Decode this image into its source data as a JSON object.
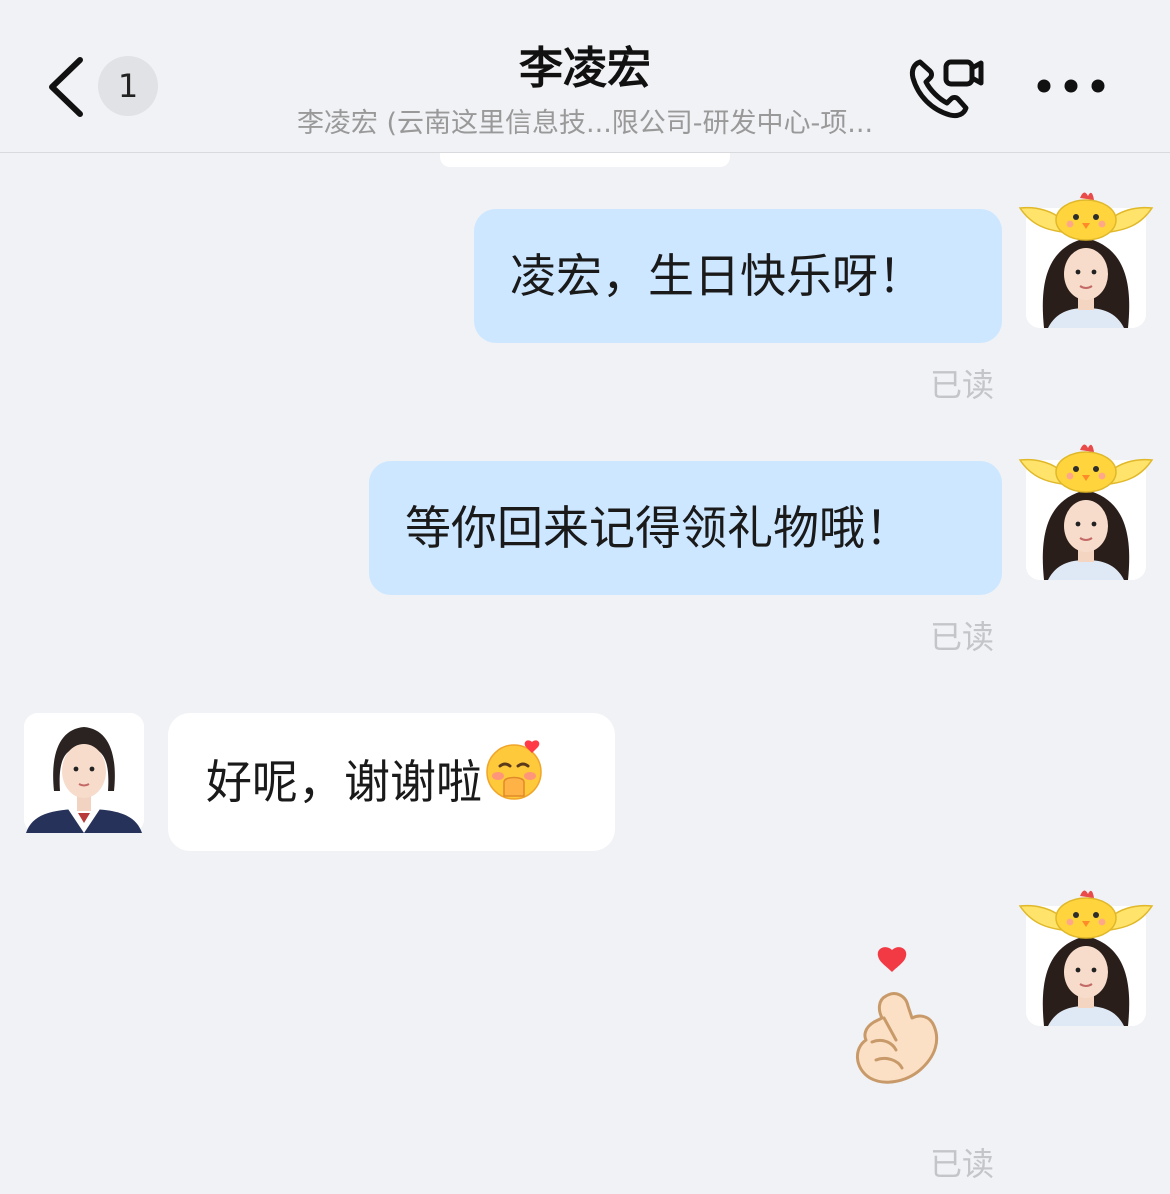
{
  "header": {
    "unread_count": "1",
    "title": "李凌宏",
    "subtitle": "李凌宏 (云南这里信息技...限公司-研发中心-项..."
  },
  "icons": {
    "back": "chevron-left-icon",
    "call": "phone-video-icon",
    "more": "more-dots-icon"
  },
  "messages": [
    {
      "sender": "me",
      "text": "凌宏，生日快乐呀！",
      "status": "已读"
    },
    {
      "sender": "me",
      "text": "等你回来记得领礼物哦！",
      "status": "已读"
    },
    {
      "sender": "them",
      "text": "好呢，谢谢啦",
      "emoji": "blushing-face-with-heart-emoji"
    },
    {
      "sender": "me",
      "sticker": "finger-heart-sticker",
      "status": "已读"
    }
  ],
  "colors": {
    "background": "#f1f2f5",
    "my_bubble": "#cce7ff",
    "their_bubble": "#ffffff",
    "read_text": "#c4c5c9"
  }
}
